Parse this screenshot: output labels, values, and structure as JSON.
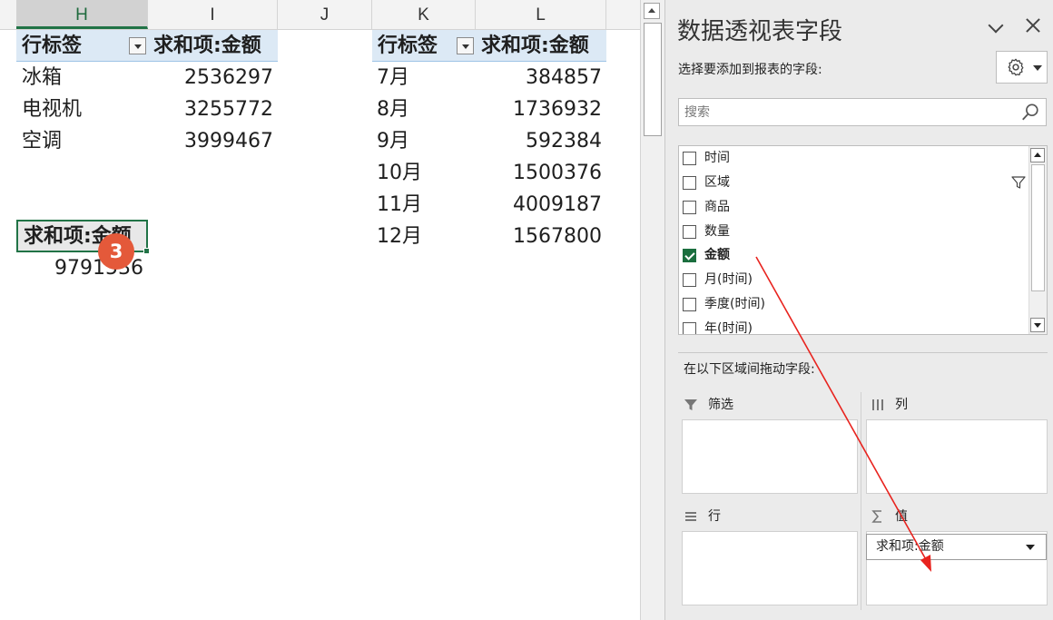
{
  "sheet": {
    "columns": [
      "H",
      "I",
      "J",
      "K",
      "L"
    ],
    "selected_column": "H",
    "pivot1": {
      "header_label": "行标签",
      "header_value": "求和项:金额",
      "rows": [
        {
          "label": "冰箱",
          "value": "2536297"
        },
        {
          "label": "电视机",
          "value": "3255772"
        },
        {
          "label": "空调",
          "value": "3999467"
        }
      ]
    },
    "pivot2": {
      "header_label": "行标签",
      "header_value": "求和项:金额",
      "rows": [
        {
          "label": "7月",
          "value": "384857"
        },
        {
          "label": "8月",
          "value": "1736932"
        },
        {
          "label": "9月",
          "value": "592384"
        },
        {
          "label": "10月",
          "value": "1500376"
        },
        {
          "label": "11月",
          "value": "4009187"
        },
        {
          "label": "12月",
          "value": "1567800"
        }
      ]
    },
    "pivot3": {
      "header_value": "求和项:金额",
      "total": "9791536"
    },
    "step_badge": "3",
    "colors": {
      "pivot_header_bg": "#dce9f5",
      "selection": "#217346",
      "badge": "#e4593a"
    }
  },
  "pane": {
    "title": "数据透视表字段",
    "subtitle": "选择要添加到报表的字段:",
    "settings_icon": "gear-icon",
    "search_placeholder": "搜索",
    "fields": [
      {
        "label": "时间",
        "checked": false
      },
      {
        "label": "区域",
        "checked": false,
        "filtered": true
      },
      {
        "label": "商品",
        "checked": false
      },
      {
        "label": "数量",
        "checked": false
      },
      {
        "label": "金额",
        "checked": true
      },
      {
        "label": "月(时间)",
        "checked": false
      },
      {
        "label": "季度(时间)",
        "checked": false
      },
      {
        "label": "年(时间)",
        "checked": false
      }
    ],
    "drag_label": "在以下区域间拖动字段:",
    "areas": {
      "filter": "筛选",
      "columns": "列",
      "rows": "行",
      "values": "值",
      "values_item": "求和项:金额"
    },
    "colors": {
      "pane_bg": "#ebebeb",
      "checkbox_checked": "#1a6e3e",
      "annotation_arrow": "#e8231e"
    }
  }
}
